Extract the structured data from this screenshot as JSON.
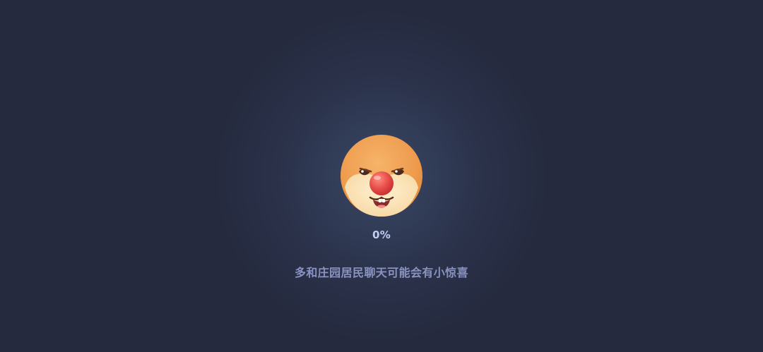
{
  "loading": {
    "mascot_icon": "hamster-face-icon",
    "progress_label": "0%",
    "progress_value": 0,
    "tip_text": "多和庄园居民聊天可能会有小惊喜"
  },
  "colors": {
    "background": "#252a3e",
    "glow": "#3a4766",
    "progress_text": "#c3ccf3",
    "tip_text": "#8a93c0"
  }
}
